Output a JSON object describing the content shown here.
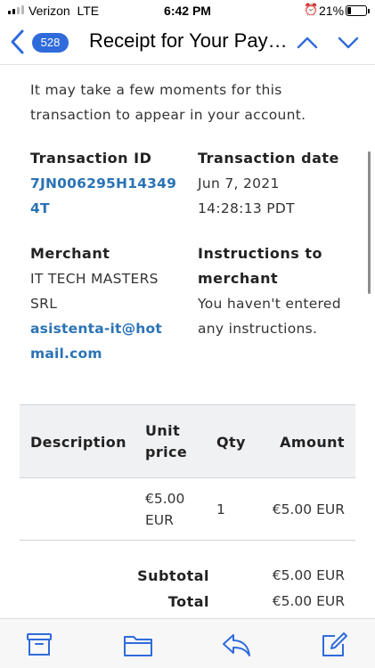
{
  "status_bar": {
    "carrier": "Verizon",
    "network": "LTE",
    "time": "6:42 PM",
    "battery_percent": "21%",
    "battery_level": 0.21,
    "signal_bars": 2
  },
  "nav": {
    "unread_count": "528",
    "title": "Receipt for Your Payment"
  },
  "message": {
    "intro": "It may take a few moments for this transaction to appear in your account.",
    "transaction_id_label": "Transaction ID",
    "transaction_id": "7JN006295H143494T",
    "transaction_date_label": "Transaction date",
    "transaction_date": "Jun 7, 2021",
    "transaction_time": "14:28:13 PDT",
    "merchant_label": "Merchant",
    "merchant_name": "IT TECH MASTERS SRL",
    "merchant_email": "asistenta-it@hotmail.com",
    "instructions_label": "Instructions to merchant",
    "instructions_text": "You haven't entered any instructions."
  },
  "table": {
    "headers": {
      "description": "Description",
      "unit_price_line1": "Unit",
      "unit_price_line2": "price",
      "qty": "Qty",
      "amount": "Amount"
    },
    "rows": [
      {
        "description": "",
        "unit_price_line1": "€5.00",
        "unit_price_line2": "EUR",
        "qty": "1",
        "amount": "€5.00 EUR"
      }
    ],
    "subtotal_label": "Subtotal",
    "subtotal_value": "€5.00 EUR",
    "total_label": "Total",
    "total_value": "€5.00 EUR"
  },
  "colors": {
    "accent": "#2f6bdb",
    "link": "#2b73b5",
    "header_bg": "#f0f1f3"
  },
  "icons": {
    "back": "chevron-left-icon",
    "prev": "chevron-up-icon",
    "next": "chevron-down-icon",
    "archive": "archive-icon",
    "folder": "folder-icon",
    "reply": "reply-icon",
    "compose": "compose-icon"
  }
}
